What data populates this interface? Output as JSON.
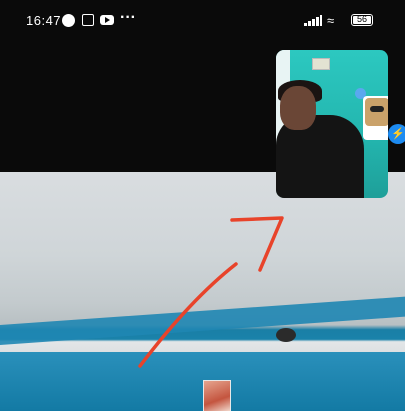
{
  "status_bar": {
    "time": "16:47",
    "battery_level": "56",
    "notification_icons": [
      "messenger-icon",
      "app-icon",
      "youtube-icon",
      "more-icon"
    ],
    "system_icons": [
      "signal-icon",
      "wifi-icon",
      "battery-icon"
    ],
    "more_label": "···"
  },
  "call": {
    "self_view_badge": "messenger-icon"
  },
  "colors": {
    "annotation": "#e8432a",
    "messenger_blue": "#1d8bf1"
  }
}
